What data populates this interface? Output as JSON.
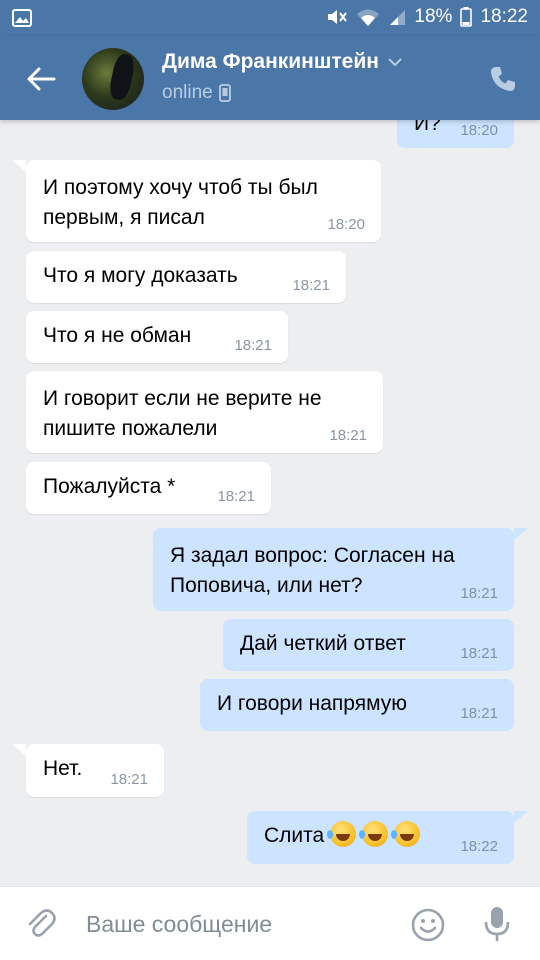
{
  "status_bar": {
    "battery": "18%",
    "time": "18:22"
  },
  "header": {
    "contact_name": "Дима Франкинштейн",
    "status": "online"
  },
  "messages": [
    {
      "direction": "out",
      "text": "И?",
      "time": "18:20"
    },
    {
      "direction": "in",
      "text": [
        "И поэтому хочу чтоб ты был",
        "первым, я писал"
      ],
      "time": "18:20"
    },
    {
      "direction": "in",
      "text": "Что я могу доказать",
      "time": "18:21"
    },
    {
      "direction": "in",
      "text": "Что я не обман",
      "time": "18:21"
    },
    {
      "direction": "in",
      "text": [
        "И говорит если не верите не",
        "пишите пожалели"
      ],
      "time": "18:21"
    },
    {
      "direction": "in",
      "text": "Пожалуйста *",
      "time": "18:21"
    },
    {
      "direction": "out",
      "text": [
        "Я задал вопрос: Согласен на",
        "Поповича, или нет?"
      ],
      "time": "18:21"
    },
    {
      "direction": "out",
      "text": "Дай четкий ответ",
      "time": "18:21"
    },
    {
      "direction": "out",
      "text": "И говори напрямую",
      "time": "18:21"
    },
    {
      "direction": "in",
      "text": "Нет.",
      "time": "18:21"
    },
    {
      "direction": "out",
      "text": "Слита",
      "emoji": [
        "rolling-on-floor-laughing",
        "rolling-on-floor-laughing",
        "rolling-on-floor-laughing"
      ],
      "time": "18:22"
    }
  ],
  "composer": {
    "placeholder": "Ваше сообщение"
  },
  "colors": {
    "header": "#4a76a8",
    "chat_bg": "#edeef0",
    "incoming_bubble": "#ffffff",
    "outgoing_bubble": "#cce4ff",
    "time": "#8a96a3"
  },
  "icons": [
    "image-notification-icon",
    "mute-icon",
    "wifi-icon",
    "signal-icon",
    "battery-icon",
    "back-arrow-icon",
    "chevron-down-icon",
    "mobile-icon",
    "phone-icon",
    "paperclip-icon",
    "smile-icon",
    "microphone-icon"
  ]
}
